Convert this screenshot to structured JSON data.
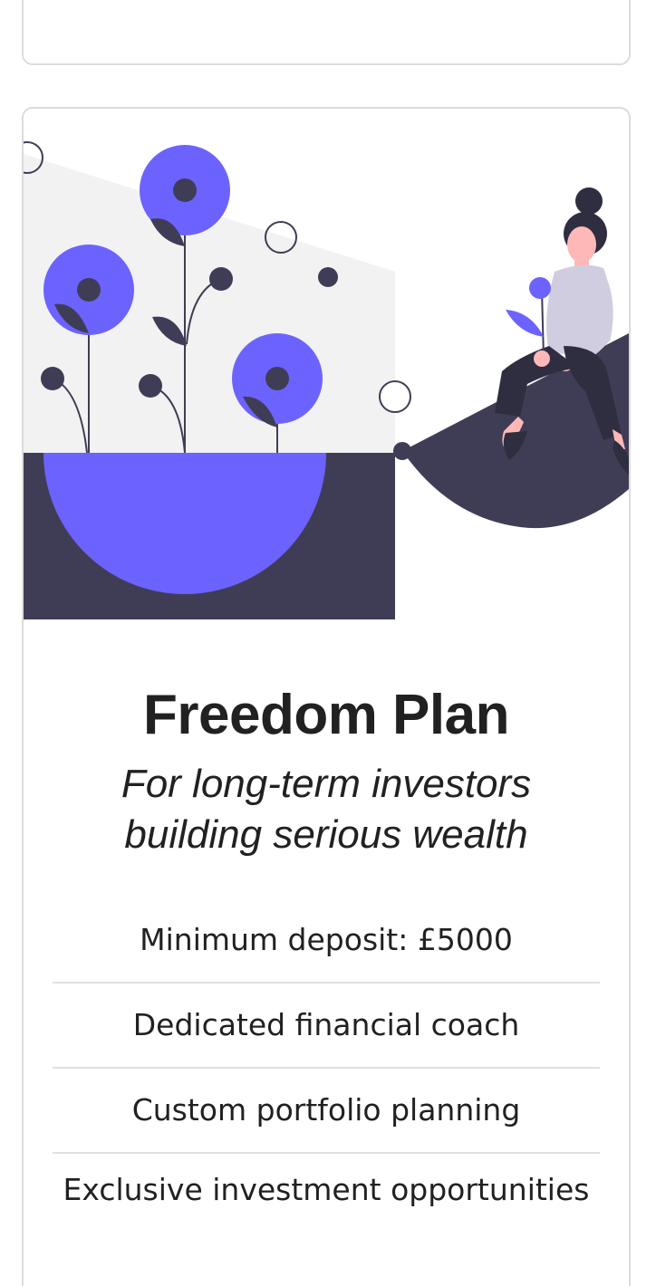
{
  "plan": {
    "title": "Freedom Plan",
    "subtitle": "For long-term investors building serious wealth",
    "features": [
      "Minimum deposit: £5000",
      "Dedicated financial coach",
      "Custom portfolio planning",
      "Exclusive investment opportunities"
    ]
  },
  "illustration": {
    "name": "woman-sitting-with-flowers-illustration",
    "colors": {
      "accent": "#6c63ff",
      "dark": "#3f3d56",
      "light_bg": "#f2f2f2",
      "skin": "#ffb8b8",
      "shirt": "#d0cde1",
      "hair": "#2f2e41"
    }
  }
}
